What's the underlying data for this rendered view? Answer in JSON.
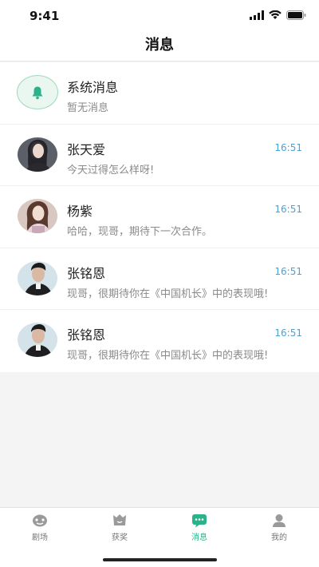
{
  "status_bar": {
    "time": "9:41"
  },
  "header": {
    "title": "消息"
  },
  "messages": [
    {
      "name": "系统消息",
      "preview": "暂无消息",
      "time": "",
      "avatar_icon": "bell-icon"
    },
    {
      "name": "张天爱",
      "preview": "今天过得怎么样呀!",
      "time": "16:51",
      "avatar_icon": "avatar-photo"
    },
    {
      "name": "杨紫",
      "preview": "哈哈，现哥，期待下一次合作。",
      "time": "16:51",
      "avatar_icon": "avatar-photo"
    },
    {
      "name": "张铭恩",
      "preview": "现哥，很期待你在《中国机长》中的表现哦!",
      "time": "16:51",
      "avatar_icon": "avatar-photo"
    },
    {
      "name": "张铭恩",
      "preview": "现哥，很期待你在《中国机长》中的表现哦!",
      "time": "16:51",
      "avatar_icon": "avatar-photo"
    }
  ],
  "tab_bar": {
    "tabs": [
      {
        "label": "剧场",
        "icon": "theater-icon",
        "active": false
      },
      {
        "label": "获奖",
        "icon": "award-icon",
        "active": false
      },
      {
        "label": "消息",
        "icon": "message-icon",
        "active": true
      },
      {
        "label": "我的",
        "icon": "profile-icon",
        "active": false
      }
    ]
  },
  "colors": {
    "accent": "#2bb28a",
    "time": "#4aa3d8",
    "background": "#f4f4f4"
  }
}
